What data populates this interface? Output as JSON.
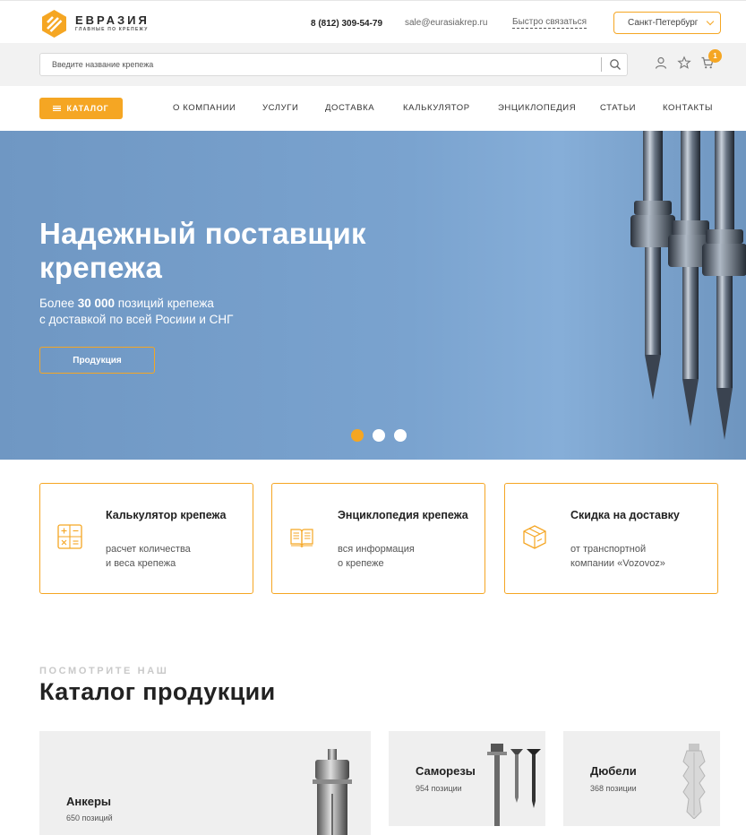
{
  "header": {
    "logo_name": "ЕВРАЗИЯ",
    "logo_tagline": "ГЛАВНЫЕ ПО КРЕПЕЖУ",
    "phone": "8 (812) 309-54-79",
    "email": "sale@eurasiakrep.ru",
    "quick_contact": "Быстро связаться",
    "city": "Санкт-Петербург"
  },
  "search": {
    "placeholder": "Введите название крепежа",
    "value": ""
  },
  "icons": {
    "search": "search-icon",
    "user": "user-icon",
    "favorites": "star-icon",
    "cart": "cart-icon",
    "cart_count": "1"
  },
  "nav": {
    "catalog_label": "КАТАЛОГ",
    "links": [
      "О КОМПАНИИ",
      "УСЛУГИ",
      "ДОСТАВКА",
      "КАЛЬКУЛЯТОР",
      "ЭНЦИКЛОПЕДИЯ",
      "СТАТЬИ",
      "КОНТАКТЫ"
    ]
  },
  "hero": {
    "title": "Надежный поставщик крепежа",
    "subtitle_prefix": "Более ",
    "subtitle_highlight": "30 000",
    "subtitle_suffix": " позиций крепежа",
    "subtitle_line2": "с доставкой по всей Росиии и СНГ",
    "cta_label": "Продукция",
    "slides_total": 3,
    "slide_active": 1
  },
  "features": [
    {
      "title": "Калькулятор крепежа",
      "desc_line1": "расчет количества",
      "desc_line2": "и веса крепежа",
      "icon": "calculator-icon"
    },
    {
      "title": "Энциклопедия крепежа",
      "desc_line1": "вся информация",
      "desc_line2": "о крепеже",
      "icon": "book-icon"
    },
    {
      "title": "Скидка на доставку",
      "desc_line1": "от транспортной",
      "desc_line2": "компании «Vozovoz»",
      "icon": "box-icon"
    }
  ],
  "catalog": {
    "eyebrow": "ПОСМОТРИТЕ НАШ",
    "title": "Каталог продукции",
    "items": [
      {
        "name": "Анкеры",
        "count": "650 позиций"
      },
      {
        "name": "Саморезы",
        "count": "954 позиции"
      },
      {
        "name": "Дюбели",
        "count": "368 позиции"
      }
    ]
  },
  "colors": {
    "accent": "#f5a623",
    "hero_bg": "#7aa3cf",
    "band_bg": "#f2f2f2"
  }
}
